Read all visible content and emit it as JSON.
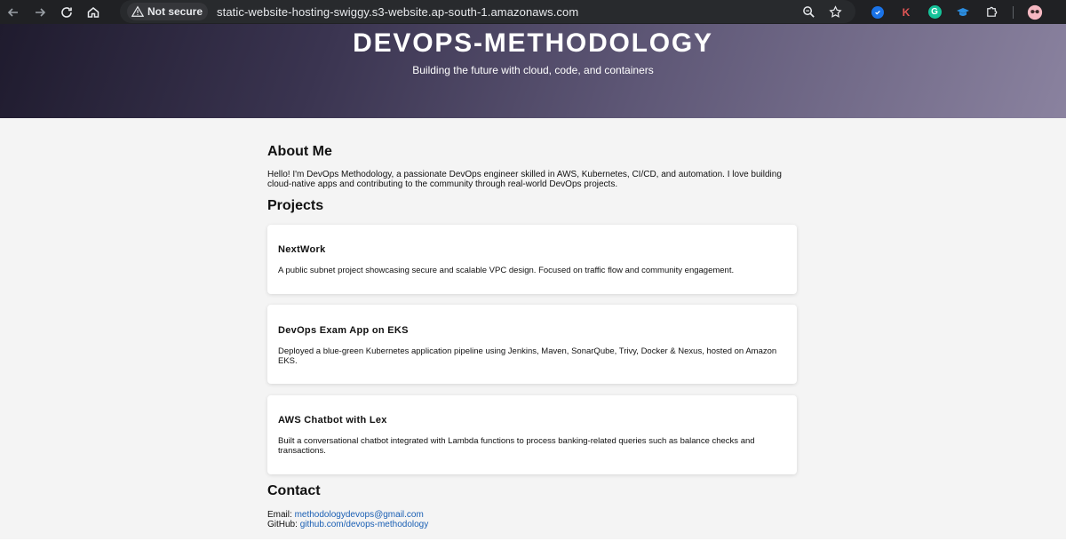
{
  "browser": {
    "security_label": "Not secure",
    "url": "static-website-hosting-swiggy.s3-website.ap-south-1.amazonaws.com",
    "extensions": [
      "check-extension-icon",
      "k-extension-icon",
      "grammarly-icon",
      "graduation-cap-icon",
      "puzzle-icon",
      "profile-avatar"
    ],
    "ext_k_label": "K",
    "ext_g_label": "G"
  },
  "hero": {
    "title": "DEVOPS-METHODOLOGY",
    "subtitle": "Building the future with cloud, code, and containers"
  },
  "about": {
    "heading": "About Me",
    "text": "Hello! I'm DevOps Methodology, a passionate DevOps engineer skilled in AWS, Kubernetes, CI/CD, and automation. I love building cloud-native apps and contributing to the community through real-world DevOps projects."
  },
  "projects": {
    "heading": "Projects",
    "items": [
      {
        "title": "NextWork",
        "description": "A public subnet project showcasing secure and scalable VPC design. Focused on traffic flow and community engagement."
      },
      {
        "title": "DevOps Exam App on EKS",
        "description": "Deployed a blue-green Kubernetes application pipeline using Jenkins, Maven, SonarQube, Trivy, Docker & Nexus, hosted on Amazon EKS."
      },
      {
        "title": "AWS Chatbot with Lex",
        "description": "Built a conversational chatbot integrated with Lambda functions to process banking-related queries such as balance checks and transactions."
      }
    ]
  },
  "contact": {
    "heading": "Contact",
    "email_label": "Email:",
    "email": "methodologydevops@gmail.com",
    "github_label": "GitHub:",
    "github": "github.com/devops-methodology"
  },
  "colors": {
    "chrome_bg": "#202124",
    "link": "#1a5fb4",
    "content_bg": "#f4f4f4"
  }
}
